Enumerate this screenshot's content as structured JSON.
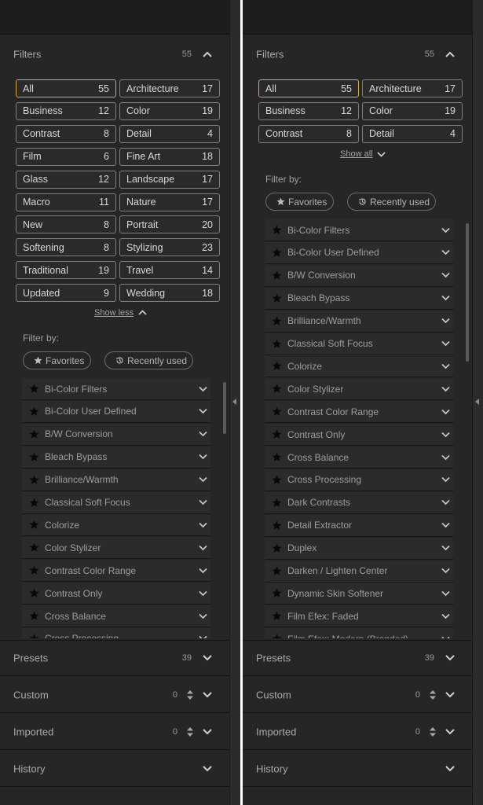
{
  "filters": {
    "title": "Filters",
    "count": "55",
    "show_less": "Show less",
    "show_all": "Show all",
    "filter_by": "Filter by:",
    "chips": [
      {
        "name": "All",
        "count": "55"
      },
      {
        "name": "Architecture",
        "count": "17"
      },
      {
        "name": "Business",
        "count": "12"
      },
      {
        "name": "Color",
        "count": "19"
      },
      {
        "name": "Contrast",
        "count": "8"
      },
      {
        "name": "Detail",
        "count": "4"
      },
      {
        "name": "Film",
        "count": "6"
      },
      {
        "name": "Fine Art",
        "count": "18"
      },
      {
        "name": "Glass",
        "count": "12"
      },
      {
        "name": "Landscape",
        "count": "17"
      },
      {
        "name": "Macro",
        "count": "11"
      },
      {
        "name": "Nature",
        "count": "17"
      },
      {
        "name": "New",
        "count": "8"
      },
      {
        "name": "Portrait",
        "count": "20"
      },
      {
        "name": "Softening",
        "count": "8"
      },
      {
        "name": "Stylizing",
        "count": "23"
      },
      {
        "name": "Traditional",
        "count": "19"
      },
      {
        "name": "Travel",
        "count": "14"
      },
      {
        "name": "Updated",
        "count": "9"
      },
      {
        "name": "Wedding",
        "count": "18"
      }
    ],
    "pills": {
      "favorites": "Favorites",
      "recently_used": "Recently used"
    },
    "presets": [
      "Bi-Color Filters",
      "Bi-Color User Defined",
      "B/W Conversion",
      "Bleach Bypass",
      "Brilliance/Warmth",
      "Classical Soft Focus",
      "Colorize",
      "Color Stylizer",
      "Contrast Color Range",
      "Contrast Only",
      "Cross Balance",
      "Cross Processing",
      "Dark Contrasts",
      "Detail Extractor",
      "Duplex",
      "Darken / Lighten Center",
      "Dynamic Skin Softener",
      "Film Efex: Faded",
      "Film Efex: Modern (Branded)"
    ]
  },
  "sections": {
    "presets": {
      "title": "Presets",
      "count": "39"
    },
    "custom": {
      "title": "Custom",
      "count": "0"
    },
    "imported": {
      "title": "Imported",
      "count": "0"
    },
    "history": {
      "title": "History"
    }
  },
  "colors": {
    "accent": "#d7ae33",
    "panel": "#262626",
    "text": "#cfcfcf"
  }
}
